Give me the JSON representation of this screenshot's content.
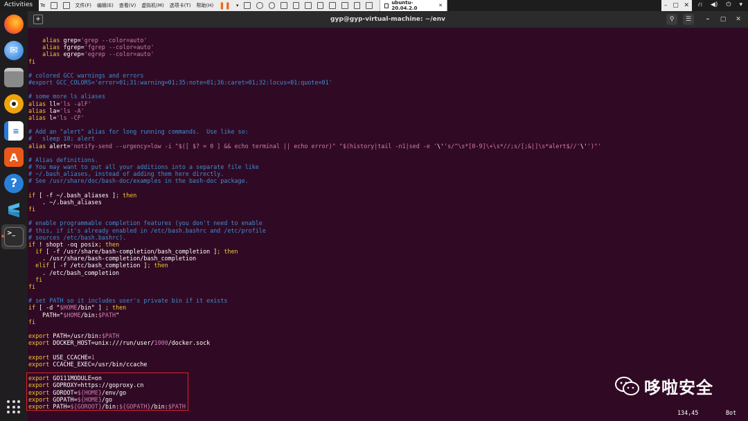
{
  "topbar": {
    "activities": "Activities",
    "tab_partial": "Te",
    "vm_menu": [
      "文件(F)",
      "编辑(E)",
      "查看(V)",
      "虚拟机(M)",
      "选项卡(T)",
      "帮助(H)"
    ],
    "vm_tab": "ubuntu-20.04.2.0"
  },
  "window": {
    "title": "gyp@gyp-virtual-machine: ~/env"
  },
  "terminal": {
    "lines": [
      {
        "t": 0,
        "parts": [
          [
            "    ",
            "p"
          ],
          [
            "alias ",
            "k"
          ],
          [
            "grep",
            "p"
          ],
          [
            "=",
            "p"
          ],
          [
            "'grep --color=auto'",
            "s"
          ]
        ]
      },
      {
        "t": 1,
        "parts": [
          [
            "    ",
            "p"
          ],
          [
            "alias ",
            "k"
          ],
          [
            "fgrep",
            "p"
          ],
          [
            "=",
            "p"
          ],
          [
            "'fgrep --color=auto'",
            "s"
          ]
        ]
      },
      {
        "t": 2,
        "parts": [
          [
            "    ",
            "p"
          ],
          [
            "alias ",
            "k"
          ],
          [
            "egrep",
            "p"
          ],
          [
            "=",
            "p"
          ],
          [
            "'egrep --color=auto'",
            "s"
          ]
        ]
      },
      {
        "t": 3,
        "parts": [
          [
            "fi",
            "k"
          ]
        ]
      },
      {
        "t": 4,
        "parts": [
          [
            "",
            "p"
          ]
        ]
      },
      {
        "t": 5,
        "parts": [
          [
            "# colored GCC warnings and errors",
            "c"
          ]
        ]
      },
      {
        "t": 6,
        "parts": [
          [
            "#export GCC_COLORS='error=01;31:warning=01;35:note=01;36:caret=01;32:locus=01:quote=01'",
            "c"
          ]
        ]
      },
      {
        "t": 7,
        "parts": [
          [
            "",
            "p"
          ]
        ]
      },
      {
        "t": 8,
        "parts": [
          [
            "# some more ls aliases",
            "c"
          ]
        ]
      },
      {
        "t": 9,
        "parts": [
          [
            "alias ",
            "k"
          ],
          [
            "ll",
            "p"
          ],
          [
            "=",
            "p"
          ],
          [
            "'ls -alF'",
            "s"
          ]
        ]
      },
      {
        "t": 10,
        "parts": [
          [
            "alias ",
            "k"
          ],
          [
            "la",
            "p"
          ],
          [
            "=",
            "p"
          ],
          [
            "'ls -A'",
            "s"
          ]
        ]
      },
      {
        "t": 11,
        "parts": [
          [
            "alias ",
            "k"
          ],
          [
            "l",
            "p"
          ],
          [
            "=",
            "p"
          ],
          [
            "'ls -CF'",
            "s"
          ]
        ]
      },
      {
        "t": 12,
        "parts": [
          [
            "",
            "p"
          ]
        ]
      },
      {
        "t": 13,
        "parts": [
          [
            "# Add an \"alert\" alias for long running commands.  Use like so:",
            "c"
          ]
        ]
      },
      {
        "t": 14,
        "parts": [
          [
            "#   sleep 10; alert",
            "c"
          ]
        ]
      },
      {
        "t": 15,
        "parts": [
          [
            "alias ",
            "k"
          ],
          [
            "alert",
            "p"
          ],
          [
            "=",
            "p"
          ],
          [
            "'notify-send --urgency=low -i \"$([ $? = 0 ] && echo terminal || echo error)\" \"$(history|tail -n1|sed -e '",
            "s"
          ],
          [
            "\\'",
            "p"
          ],
          [
            "'s/^\\s*[0-9]\\+\\s*//;s/[;&|]\\s*alert$//'",
            "s"
          ],
          [
            "\\'",
            "p"
          ],
          [
            "')\"'",
            "s"
          ]
        ]
      },
      {
        "t": 16,
        "parts": [
          [
            "",
            "p"
          ]
        ]
      },
      {
        "t": 17,
        "parts": [
          [
            "# Alias definitions.",
            "c"
          ]
        ]
      },
      {
        "t": 18,
        "parts": [
          [
            "# You may want to put all your additions into a separate file like",
            "c"
          ]
        ]
      },
      {
        "t": 19,
        "parts": [
          [
            "# ~/.bash_aliases, instead of adding them here directly.",
            "c"
          ]
        ]
      },
      {
        "t": 20,
        "parts": [
          [
            "# See /usr/share/doc/bash-doc/examples in the bash-doc package.",
            "c"
          ]
        ]
      },
      {
        "t": 21,
        "parts": [
          [
            "",
            "p"
          ]
        ]
      },
      {
        "t": 22,
        "parts": [
          [
            "if",
            "k"
          ],
          [
            " [ -f ~/.bash_aliases ]",
            "p"
          ],
          [
            "; then",
            "k"
          ]
        ]
      },
      {
        "t": 23,
        "parts": [
          [
            "    . ~/.bash_aliases",
            "p"
          ]
        ]
      },
      {
        "t": 24,
        "parts": [
          [
            "fi",
            "k"
          ]
        ]
      },
      {
        "t": 25,
        "parts": [
          [
            "",
            "p"
          ]
        ]
      },
      {
        "t": 26,
        "parts": [
          [
            "# enable programmable completion features (you don't need to enable",
            "c"
          ]
        ]
      },
      {
        "t": 27,
        "parts": [
          [
            "# this, if it's already enabled in /etc/bash.bashrc and /etc/profile",
            "c"
          ]
        ]
      },
      {
        "t": 28,
        "parts": [
          [
            "# sources /etc/bash.bashrc).",
            "c"
          ]
        ]
      },
      {
        "t": 29,
        "parts": [
          [
            "if",
            "k"
          ],
          [
            " ! shopt -oq posix",
            "p"
          ],
          [
            "; then",
            "k"
          ]
        ]
      },
      {
        "t": 30,
        "parts": [
          [
            "  if",
            "k"
          ],
          [
            " [ -f /usr/share/bash-completion/bash_completion ]",
            "p"
          ],
          [
            "; then",
            "k"
          ]
        ]
      },
      {
        "t": 31,
        "parts": [
          [
            "    . /usr/share/bash-completion/bash_completion",
            "p"
          ]
        ]
      },
      {
        "t": 32,
        "parts": [
          [
            "  elif",
            "k"
          ],
          [
            " [ -f /etc/bash_completion ]",
            "p"
          ],
          [
            "; then",
            "k"
          ]
        ]
      },
      {
        "t": 33,
        "parts": [
          [
            "    . /etc/bash_completion",
            "p"
          ]
        ]
      },
      {
        "t": 34,
        "parts": [
          [
            "  fi",
            "k"
          ]
        ]
      },
      {
        "t": 35,
        "parts": [
          [
            "fi",
            "k"
          ]
        ]
      },
      {
        "t": 36,
        "parts": [
          [
            "",
            "p"
          ]
        ]
      },
      {
        "t": 37,
        "parts": [
          [
            "# set PATH so it includes user's private bin if it exists",
            "c"
          ]
        ]
      },
      {
        "t": 38,
        "parts": [
          [
            "if",
            "k"
          ],
          [
            " [ -d \"",
            "p"
          ],
          [
            "$HOME",
            "v"
          ],
          [
            "/bin\" ] ",
            "p"
          ],
          [
            "; then",
            "k"
          ]
        ]
      },
      {
        "t": 39,
        "parts": [
          [
            "    PATH=\"",
            "p"
          ],
          [
            "$HOME",
            "v"
          ],
          [
            "/bin:",
            "p"
          ],
          [
            "$PATH",
            "v"
          ],
          [
            "\"",
            "p"
          ]
        ]
      },
      {
        "t": 40,
        "parts": [
          [
            "fi",
            "k"
          ]
        ]
      },
      {
        "t": 41,
        "parts": [
          [
            "",
            "p"
          ]
        ]
      },
      {
        "t": 42,
        "parts": [
          [
            "export ",
            "k"
          ],
          [
            "PATH",
            "p"
          ],
          [
            "=/usr/bin:",
            "p"
          ],
          [
            "$PATH",
            "v"
          ]
        ]
      },
      {
        "t": 43,
        "parts": [
          [
            "export ",
            "k"
          ],
          [
            "DOCKER_HOST",
            "p"
          ],
          [
            "=unix:///run/user/",
            "p"
          ],
          [
            "1000",
            "v"
          ],
          [
            "/docker.sock",
            "p"
          ]
        ]
      },
      {
        "t": 44,
        "parts": [
          [
            "",
            "p"
          ]
        ]
      },
      {
        "t": 45,
        "parts": [
          [
            "export ",
            "k"
          ],
          [
            "USE_CCACHE",
            "p"
          ],
          [
            "=",
            "p"
          ],
          [
            "1",
            "v"
          ]
        ]
      },
      {
        "t": 46,
        "parts": [
          [
            "export ",
            "k"
          ],
          [
            "CCACHE_EXEC",
            "p"
          ],
          [
            "=/usr/bin/ccache",
            "p"
          ]
        ]
      },
      {
        "t": 47,
        "parts": [
          [
            "",
            "p"
          ]
        ]
      },
      {
        "t": 48,
        "parts": [
          [
            "export ",
            "k"
          ],
          [
            "GO111MODULE",
            "p"
          ],
          [
            "=on",
            "p"
          ]
        ]
      },
      {
        "t": 49,
        "parts": [
          [
            "export ",
            "k"
          ],
          [
            "GOPROXY",
            "p"
          ],
          [
            "=https://goproxy.cn",
            "p"
          ]
        ]
      },
      {
        "t": 50,
        "parts": [
          [
            "export ",
            "k"
          ],
          [
            "GOROOT",
            "p"
          ],
          [
            "=",
            "p"
          ],
          [
            "${HOME}",
            "v"
          ],
          [
            "/env/go",
            "p"
          ]
        ]
      },
      {
        "t": 51,
        "parts": [
          [
            "export ",
            "k"
          ],
          [
            "GOPATH",
            "p"
          ],
          [
            "=",
            "p"
          ],
          [
            "${HOME}",
            "v"
          ],
          [
            "/go",
            "p"
          ]
        ]
      },
      {
        "t": 52,
        "parts": [
          [
            "export ",
            "k"
          ],
          [
            "PATH",
            "p"
          ],
          [
            "=",
            "p"
          ],
          [
            "${GOROOT}",
            "v"
          ],
          [
            "/bin:",
            "p"
          ],
          [
            "${GOPATH}",
            "v"
          ],
          [
            "/bin:",
            "p"
          ],
          [
            "$PATH",
            "v"
          ]
        ]
      }
    ],
    "cursor_position": "134,45",
    "scroll_indicator": "Bot"
  },
  "watermark": {
    "text": "哆啦安全"
  },
  "dock": {
    "items": [
      "firefox-icon",
      "thunderbird-icon",
      "files-icon",
      "rhythmbox-icon",
      "writer-icon",
      "software-icon",
      "help-icon",
      "sublime-icon",
      "terminal-icon"
    ]
  },
  "colors": {
    "terminal_bg": "#300a24",
    "comment": "#3d8fd1",
    "keyword": "#f2c832",
    "string": "#d17bb2",
    "highlight_box": "#e0202c"
  }
}
